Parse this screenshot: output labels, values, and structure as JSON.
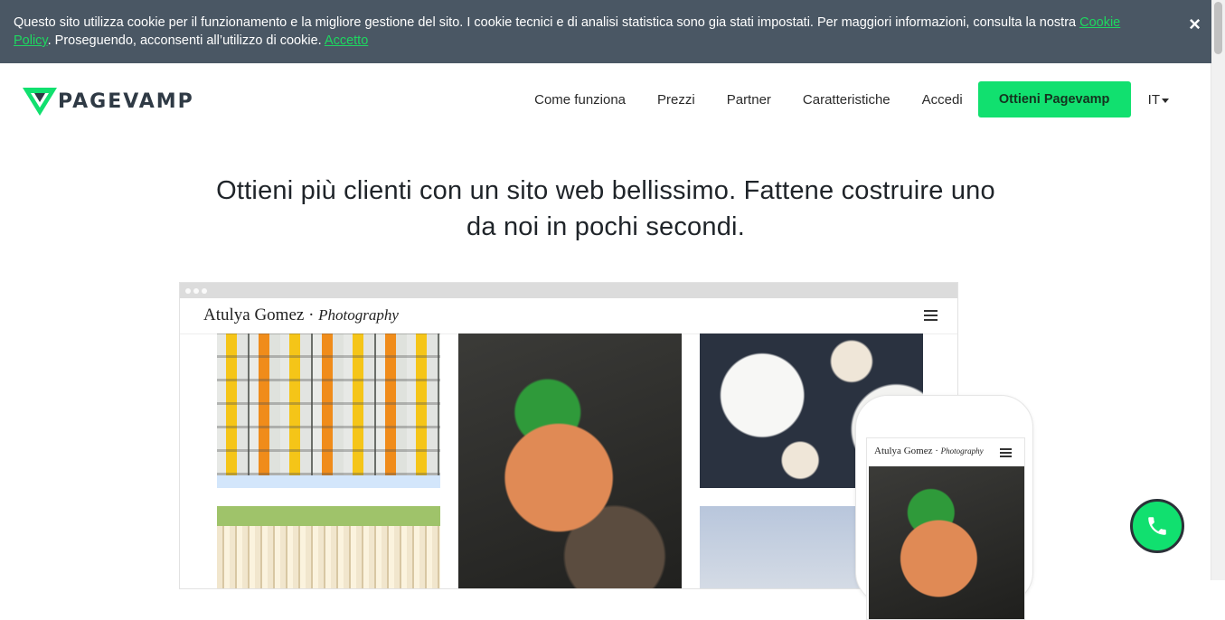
{
  "cookie": {
    "text_before": "Questo sito utilizza cookie per il funzionamento e la migliore gestione del sito. I cookie tecnici e di analisi statistica sono gia stati impostati. Per maggiori informazioni, consulta la nostra ",
    "policy_link": "Cookie Policy",
    "text_after": ". Proseguendo, acconsenti all’utilizzo di cookie. ",
    "accept_link": "Accetto",
    "close_symbol": "×"
  },
  "brand": {
    "name": "PAGEVAMP",
    "color": "#11e06f"
  },
  "nav": {
    "items": [
      "Come funziona",
      "Prezzi",
      "Partner",
      "Caratteristiche",
      "Accedi"
    ],
    "cta": "Ottieni Pagevamp",
    "lang": "IT"
  },
  "hero": {
    "headline_line1": "Ottieni più clienti con un sito web bellissimo. Fattene costruire uno",
    "headline_line2": "da noi in pochi secondi."
  },
  "mock_site": {
    "title_name": "Atulya Gomez · ",
    "title_italic": "Photography"
  },
  "icons": {
    "close": "close-icon",
    "menu": "hamburger-menu-icon",
    "phone": "phone-icon",
    "caret": "chevron-down-icon"
  },
  "colors": {
    "cookie_bar": "#4a5764",
    "accent": "#11e06f",
    "link": "#1ed760"
  }
}
